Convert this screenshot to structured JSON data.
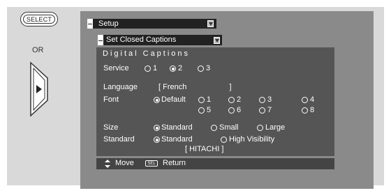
{
  "remote": {
    "select_label": "SELECT",
    "or_label": "OR"
  },
  "menu": {
    "setup_label": "Setup",
    "submenu_label": "Set Closed Captions"
  },
  "panel": {
    "title": "Digital Captions",
    "service": {
      "label": "Service",
      "options": [
        "1",
        "2",
        "3"
      ],
      "selected": "2"
    },
    "language": {
      "label": "Language",
      "value": "[ French                    ]"
    },
    "font": {
      "label": "Font",
      "default_label": "Default",
      "options": [
        "1",
        "2",
        "3",
        "4",
        "5",
        "6",
        "7",
        "8"
      ],
      "selected": "Default"
    },
    "size": {
      "label": "Size",
      "options": [
        "Standard",
        "Small",
        "Large"
      ],
      "selected": "Standard"
    },
    "standard": {
      "label": "Standard",
      "options": [
        "Standard",
        "High Visibility"
      ],
      "selected": "Standard"
    },
    "brand": "[ HITACHI ]"
  },
  "footer": {
    "move_label": "Move",
    "sel_key": "SEL",
    "return_label": "Return"
  }
}
